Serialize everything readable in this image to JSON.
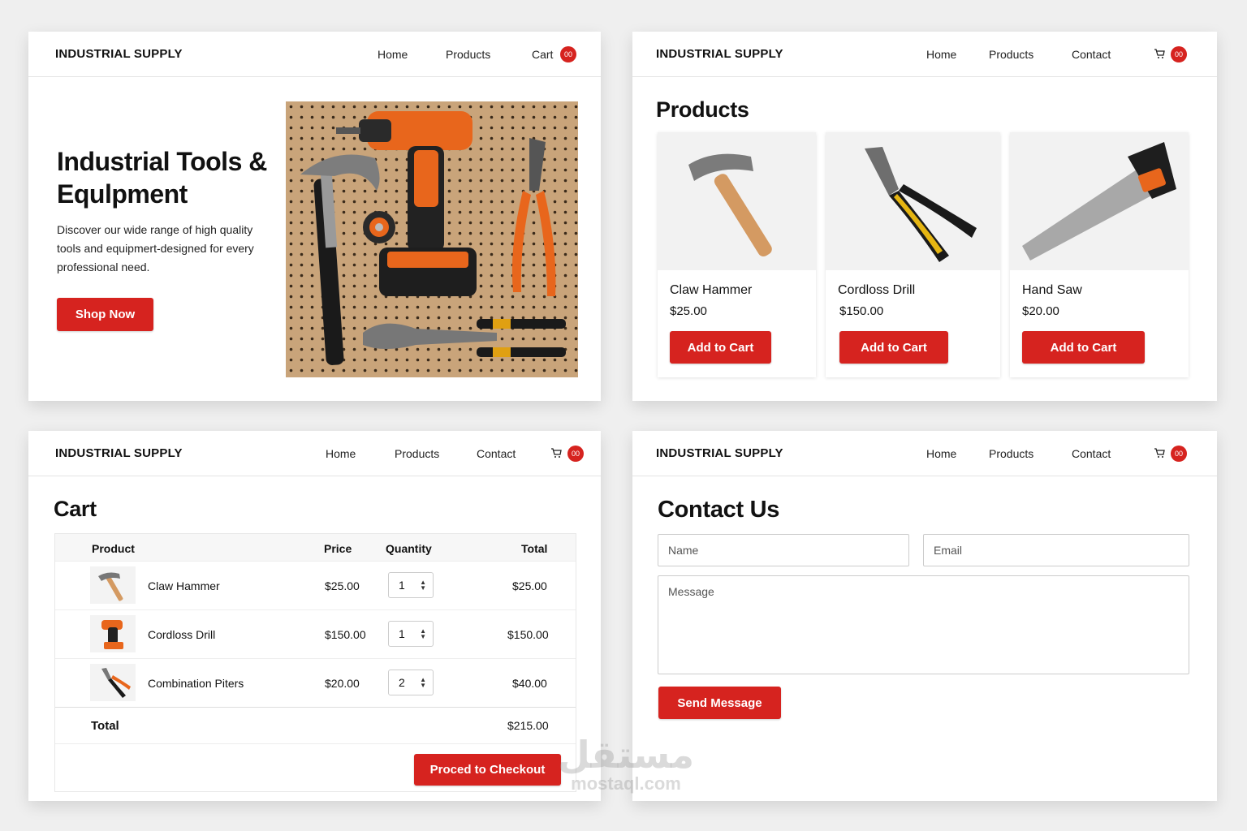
{
  "brand": "INDUSTRIAL SUPPLY",
  "accent_color": "#d6231f",
  "cart_badge": "00",
  "nav": {
    "home": "Home",
    "products": "Products",
    "contact": "Contact",
    "cart": "Cart"
  },
  "home": {
    "title": "Industrial Tools & Equlpment",
    "subtitle": "Discover our wide range of high quality tools and equipmert-designed for every professional need.",
    "cta": "Shop Now"
  },
  "products_page": {
    "heading": "Products",
    "items": [
      {
        "name": "Claw Hammer",
        "price": "$25.00",
        "button": "Add to Cart",
        "icon": "hammer-icon"
      },
      {
        "name": "Cordloss Drill",
        "price": "$150.00",
        "button": "Add to Cart",
        "icon": "pliers-icon"
      },
      {
        "name": "Hand Saw",
        "price": "$20.00",
        "button": "Add to Cart",
        "icon": "saw-icon"
      }
    ]
  },
  "cart_page": {
    "heading": "Cart",
    "columns": {
      "product": "Product",
      "price": "Price",
      "quantity": "Quantity",
      "total": "Total"
    },
    "rows": [
      {
        "name": "Claw Hammer",
        "price": "$25.00",
        "qty": "1",
        "total": "$25.00",
        "icon": "hammer-icon"
      },
      {
        "name": "Cordloss Drill",
        "price": "$150.00",
        "qty": "1",
        "total": "$150.00",
        "icon": "drill-icon"
      },
      {
        "name": "Combination Piters",
        "price": "$20.00",
        "qty": "2",
        "total": "$40.00",
        "icon": "pliers-icon"
      }
    ],
    "total_label": "Total",
    "total_value": "$215.00",
    "checkout": "Proced to Checkout"
  },
  "contact_page": {
    "heading": "Contact Us",
    "name_placeholder": "Name",
    "email_placeholder": "Email",
    "message_placeholder": "Message",
    "send": "Send Message"
  },
  "watermark": {
    "arabic": "مستقل",
    "latin": "mostaql.com"
  }
}
